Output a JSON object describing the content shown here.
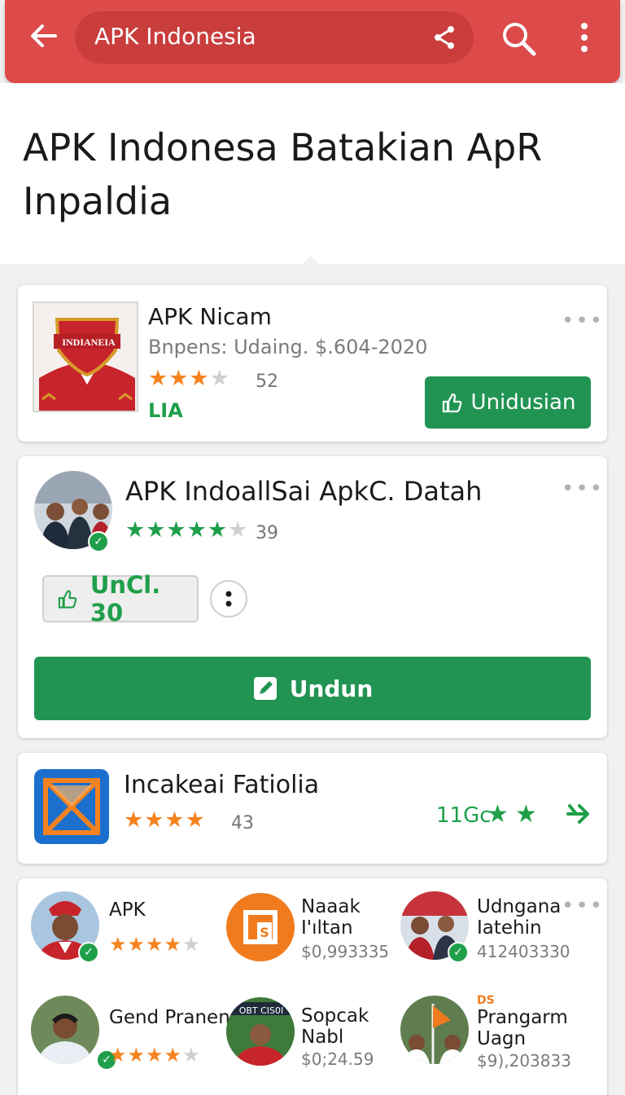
{
  "toolbar": {
    "search_value": "APK Indonesia",
    "accent": "#dc4a4a"
  },
  "header": {
    "title": "APK Indonesa Batakian ApR Inpaldia"
  },
  "card1": {
    "title": "APK Nicam",
    "subtitle": "Bnpens: Udaing. $.604-2020",
    "stars_filled": 3,
    "stars_total": 4,
    "rating_count": "52",
    "tag": "LIA",
    "thumb_label": "INDIANEIA",
    "button_label": "Unidusian"
  },
  "card2": {
    "title": "APK IndoallSai ApkC. Datah",
    "stars_filled": 5,
    "stars_total": 6,
    "rating_count": "39",
    "pill_label": "UnCl. 30",
    "download_label": "Undun"
  },
  "card3": {
    "title": "Incakeai Fatiolia",
    "stars_filled": 4,
    "rating_count": "43",
    "size_label": "11Gc"
  },
  "grid": {
    "items": [
      {
        "title": "APK",
        "title2": "",
        "sub": "",
        "stars": 4
      },
      {
        "title": "Naaak",
        "title2": "I'ıltan",
        "sub": "$0,993335"
      },
      {
        "title": "Udngana",
        "title2": "Iatehin",
        "sub": "412403330"
      },
      {
        "title": "Gend Pranen",
        "title2": "",
        "sub": "",
        "stars": 4
      },
      {
        "title": "Sopcak",
        "title2": "Nabl",
        "sub": "$0;24.59",
        "badge": "OBT CIS0I"
      },
      {
        "title": "Prangarm",
        "title2": "Uagn",
        "sub": "$9),203833",
        "badge": "DS"
      }
    ]
  }
}
